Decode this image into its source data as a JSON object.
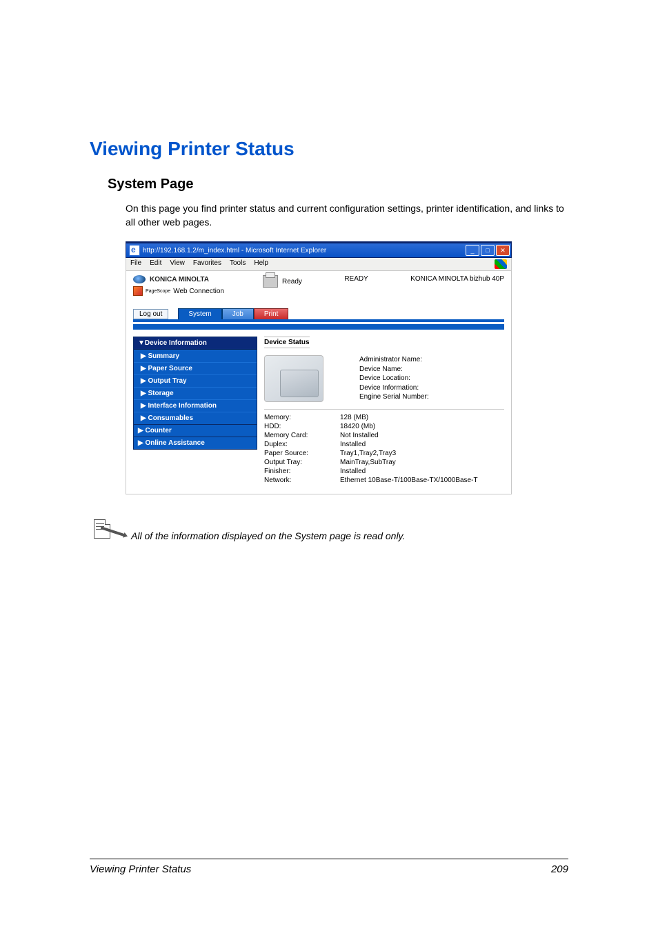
{
  "headings": {
    "h1": "Viewing Printer Status",
    "h2": "System Page"
  },
  "intro": "On this page you find printer status and current configuration settings, printer identification, and links to all other web pages.",
  "window": {
    "title": "http://192.168.1.2/m_index.html - Microsoft Internet Explorer",
    "menus": [
      "File",
      "Edit",
      "View",
      "Favorites",
      "Tools",
      "Help"
    ]
  },
  "brand": {
    "name": "KONICA MINOLTA",
    "pagescope": "PageScope",
    "web_connection": "Web Connection"
  },
  "status": {
    "icon_label": "Ready",
    "ready": "READY",
    "model": "KONICA MINOLTA bizhub 40P"
  },
  "logout": "Log out",
  "tabs": {
    "system": "System",
    "job": "Job",
    "print": "Print"
  },
  "sidebar": {
    "group_header": "▼Device Information",
    "items": [
      "▶ Summary",
      "▶ Paper Source",
      "▶ Output Tray",
      "▶ Storage",
      "▶ Interface Information",
      "▶ Consumables"
    ],
    "solo": [
      "▶ Counter",
      "▶ Online Assistance"
    ]
  },
  "details": {
    "title": "Device Status",
    "info_labels": [
      "Administrator Name:",
      "Device Name:",
      "Device Location:",
      "Device Information:",
      "Engine Serial Number:"
    ],
    "kv": [
      {
        "k": "Memory:",
        "v": "128 (MB)"
      },
      {
        "k": "HDD:",
        "v": "18420 (Mb)"
      },
      {
        "k": "Memory Card:",
        "v": "Not Installed"
      },
      {
        "k": "Duplex:",
        "v": "Installed"
      },
      {
        "k": "Paper Source:",
        "v": "Tray1,Tray2,Tray3"
      },
      {
        "k": "Output Tray:",
        "v": "MainTray,SubTray"
      },
      {
        "k": "Finisher:",
        "v": "Installed"
      },
      {
        "k": "Network:",
        "v": "Ethernet 10Base-T/100Base-TX/1000Base-T"
      }
    ]
  },
  "note": "All of the information displayed on the System page is read only.",
  "footer": {
    "left": "Viewing Printer Status",
    "right": "209"
  }
}
